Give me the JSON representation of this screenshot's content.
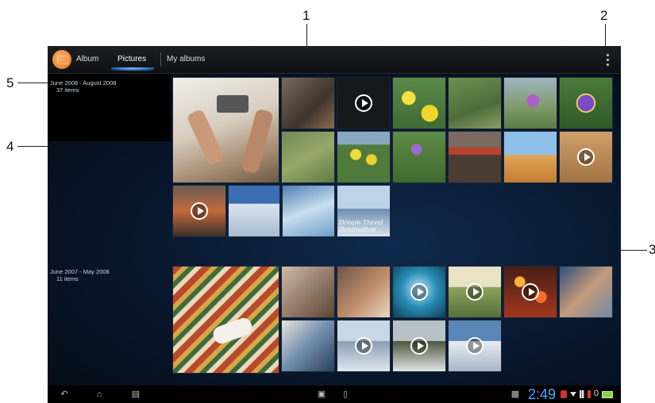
{
  "callouts": {
    "c1": "1",
    "c2": "2",
    "c3": "3",
    "c4": "4",
    "c5": "5"
  },
  "action_bar": {
    "album_label": "Album",
    "tab_pictures": "Pictures",
    "tab_my_albums": "My albums"
  },
  "groups": [
    {
      "date_range": "June 2008 - August 2008",
      "count": "37 items"
    },
    {
      "date_range": "June 2007 - May 2008",
      "count": "11 items"
    }
  ],
  "thumbnails": {
    "destination_text": "Dream Travel Destination"
  },
  "status_bar": {
    "clock": "2:49",
    "battery_level": "0"
  },
  "colors": {
    "clock": "#49a7ff",
    "tab_underline": "#2b6ecf",
    "background": "#08162b"
  }
}
